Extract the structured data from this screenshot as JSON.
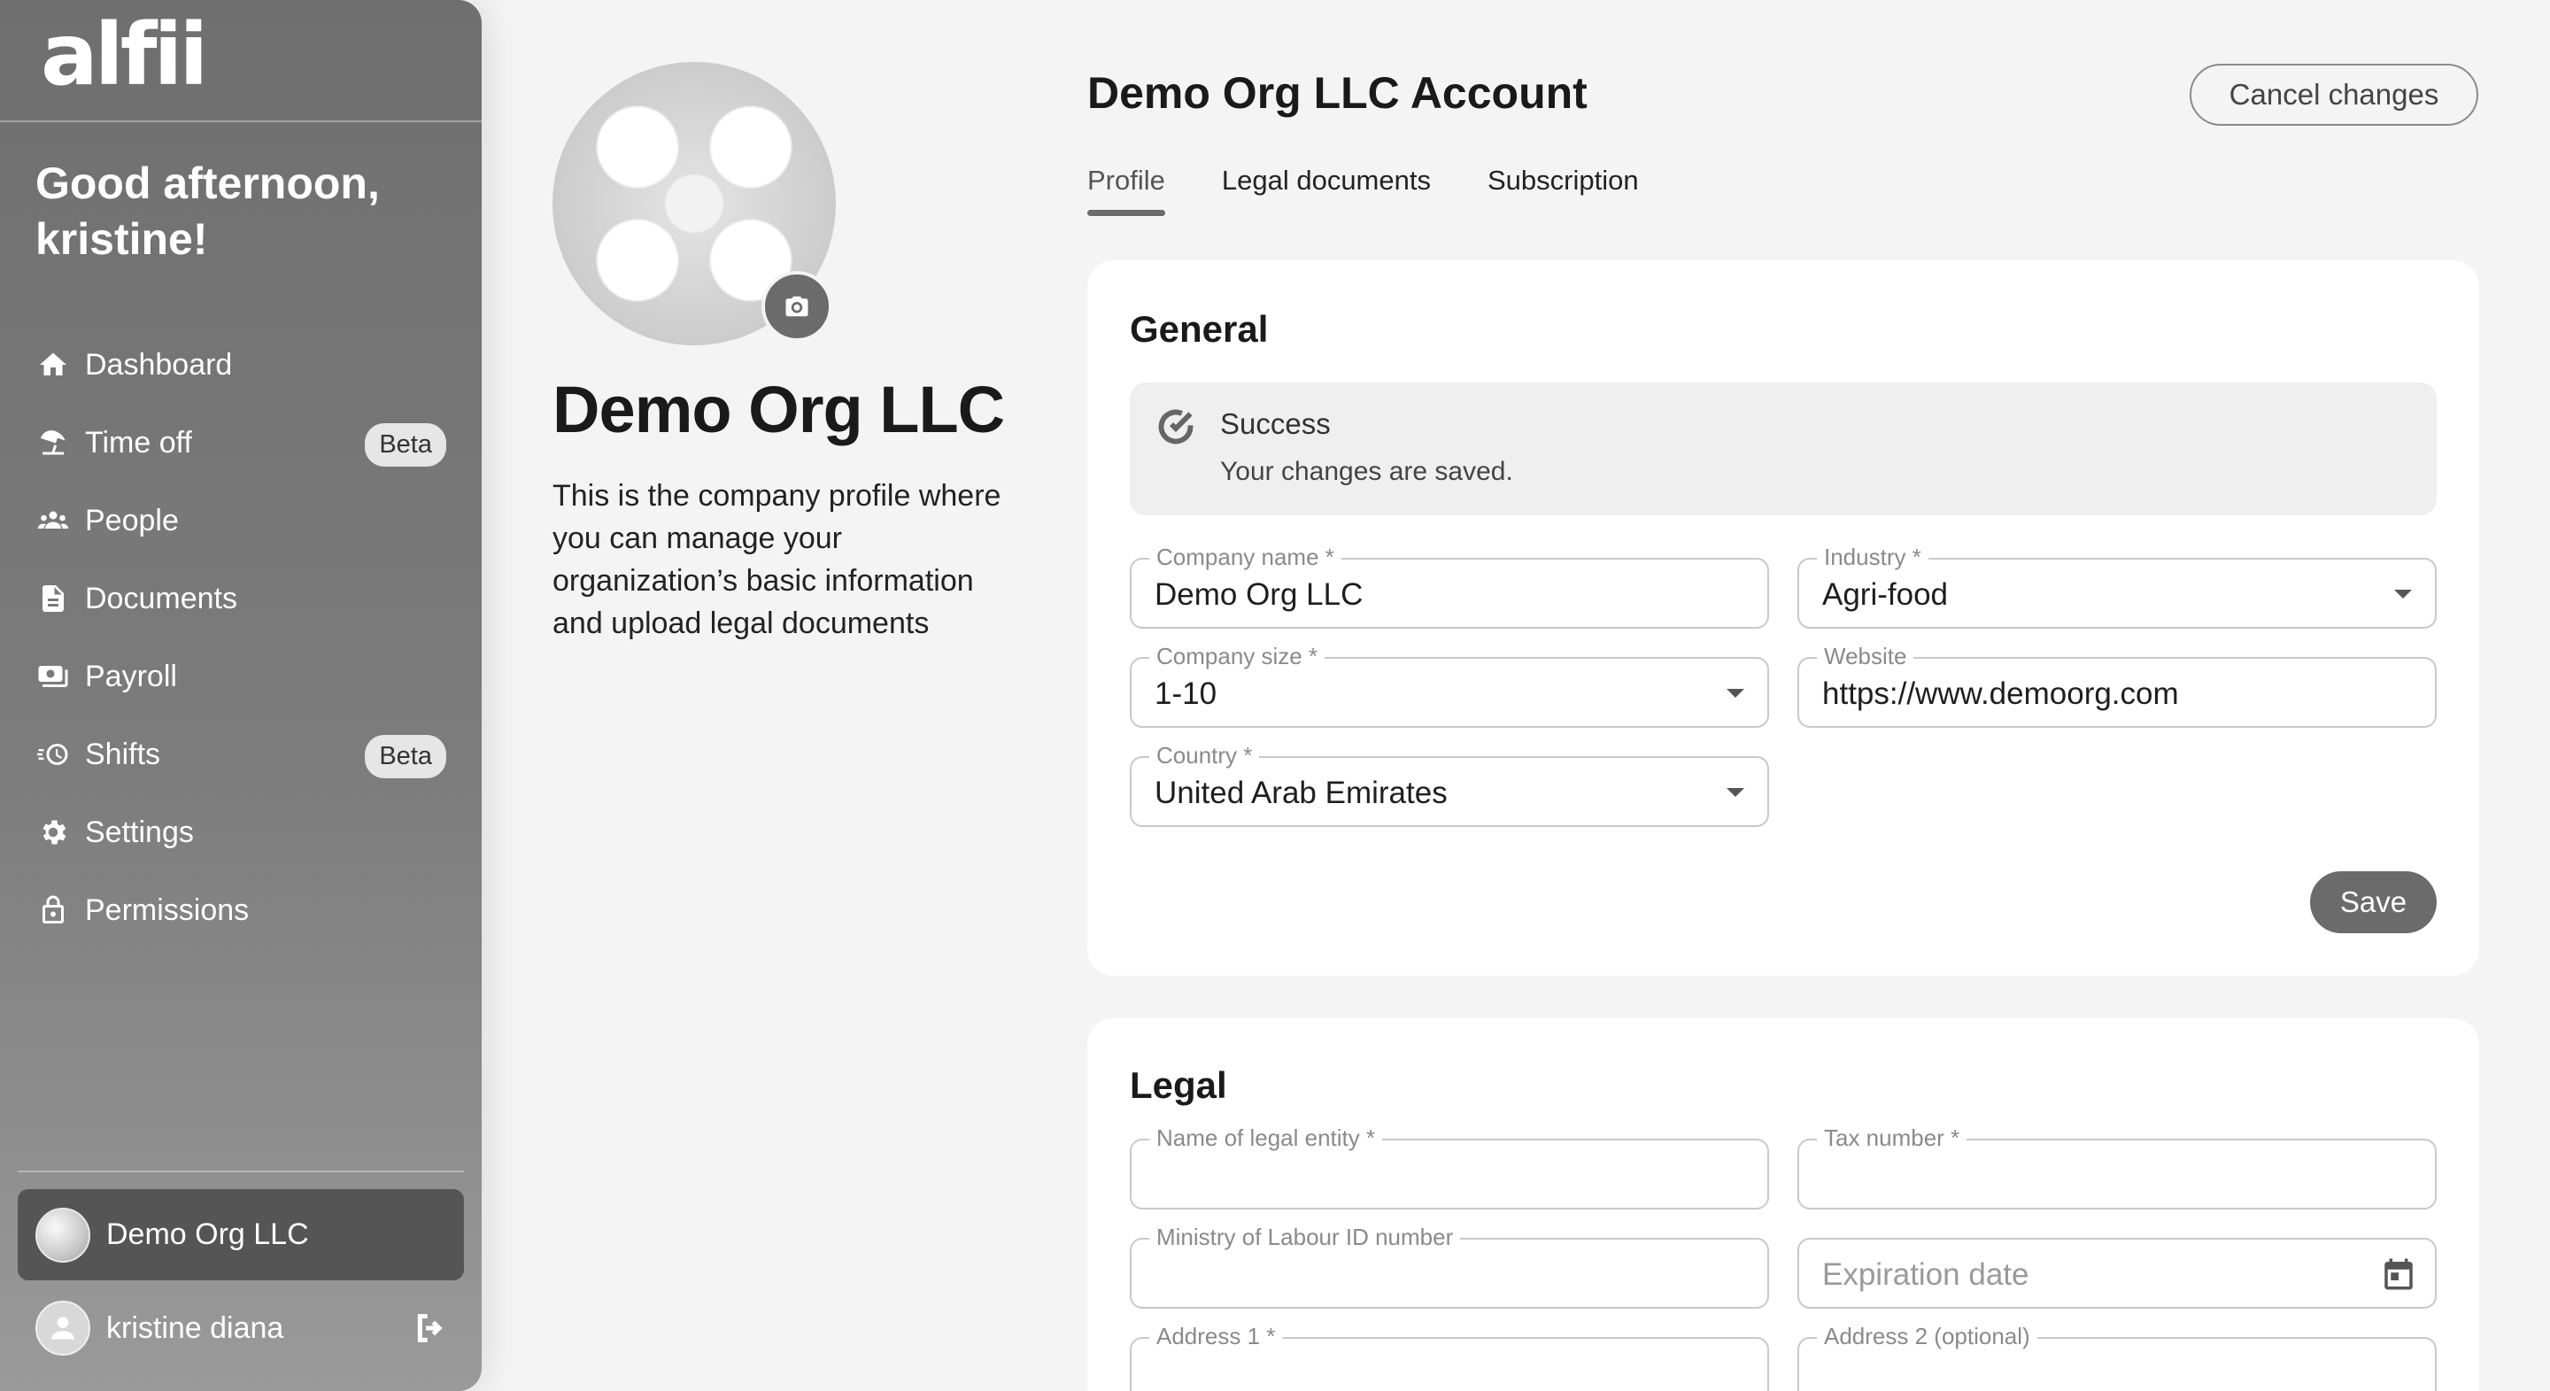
{
  "sidebar": {
    "logo": "alfii",
    "greeting": "Good afternoon, kristine!",
    "nav": [
      {
        "label": "Dashboard",
        "icon": "home-icon"
      },
      {
        "label": "Time off",
        "icon": "beach-umbrella-icon",
        "badge": "Beta"
      },
      {
        "label": "People",
        "icon": "people-icon"
      },
      {
        "label": "Documents",
        "icon": "document-icon"
      },
      {
        "label": "Payroll",
        "icon": "payroll-icon"
      },
      {
        "label": "Shifts",
        "icon": "clock-icon",
        "badge": "Beta"
      },
      {
        "label": "Settings",
        "icon": "gear-icon"
      },
      {
        "label": "Permissions",
        "icon": "lock-icon"
      }
    ],
    "org_name": "Demo Org LLC",
    "user_name": "kristine diana"
  },
  "company": {
    "name": "Demo Org LLC",
    "description": "This is the company profile where you can manage your organization’s basic information and upload legal documents"
  },
  "header": {
    "title": "Demo Org LLC Account",
    "cancel_label": "Cancel changes",
    "tabs": [
      "Profile",
      "Legal documents",
      "Subscription"
    ],
    "active_tab": "Profile"
  },
  "general": {
    "title": "General",
    "alert_title": "Success",
    "alert_message": "Your changes are saved.",
    "fields": {
      "company_name": {
        "label": "Company name *",
        "value": "Demo Org LLC"
      },
      "industry": {
        "label": "Industry *",
        "value": "Agri-food"
      },
      "company_size": {
        "label": "Company size *",
        "value": "1-10"
      },
      "website": {
        "label": "Website",
        "value": "https://www.demoorg.com"
      },
      "country": {
        "label": "Country *",
        "value": "United Arab Emirates"
      }
    },
    "save_label": "Save"
  },
  "legal": {
    "title": "Legal",
    "fields": {
      "legal_entity": {
        "label": "Name of legal entity *",
        "value": ""
      },
      "tax_number": {
        "label": "Tax number *",
        "value": ""
      },
      "mol_id": {
        "label": "Ministry of Labour ID number",
        "value": ""
      },
      "expiration": {
        "placeholder": "Expiration date"
      },
      "address1": {
        "label": "Address 1 *",
        "value": ""
      },
      "address2": {
        "label": "Address 2 (optional)",
        "value": ""
      }
    }
  },
  "colors": {
    "accent": "#6b6b6b",
    "background": "#f4f4f4",
    "card": "#ffffff"
  }
}
